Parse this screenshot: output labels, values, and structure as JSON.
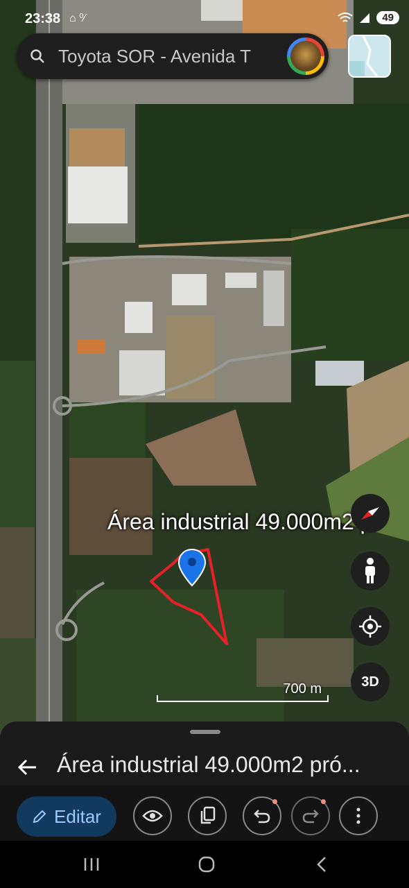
{
  "status": {
    "time": "23:38",
    "left_icons": "⌂ ⁰⁄",
    "battery": "49"
  },
  "search": {
    "text": "Toyota SOR - Avenida T"
  },
  "map": {
    "pin_label": "Área industrial 49.000m2 p",
    "scale_label": "700 m",
    "threed_label": "3D"
  },
  "sheet": {
    "title": "Área industrial 49.000m2 pró..."
  },
  "toolbar": {
    "edit_label": "Editar"
  },
  "colors": {
    "polygon": "#e8202a",
    "pin": "#1a73e8",
    "edit_bg": "#123a5e",
    "edit_fg": "#9ec9ff"
  },
  "icons": [
    "search-icon",
    "avatar",
    "layers-icon",
    "compass-icon",
    "person-icon",
    "locate-icon",
    "back-arrow-icon",
    "pencil-icon",
    "eye-icon",
    "copy-icon",
    "undo-icon",
    "redo-icon",
    "more-icon",
    "recents-icon",
    "home-icon",
    "back-icon"
  ]
}
